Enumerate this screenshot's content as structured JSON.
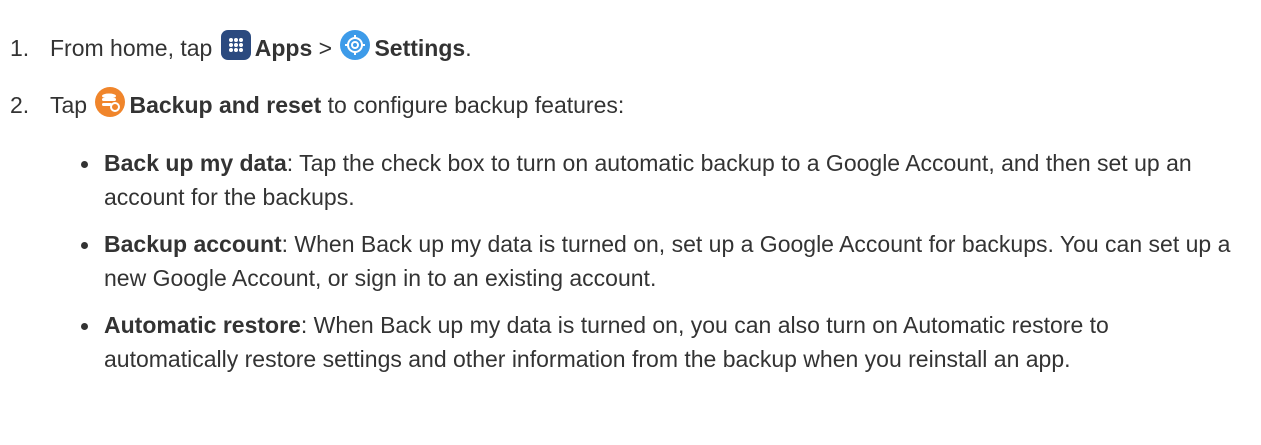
{
  "steps": [
    {
      "number": "1.",
      "text_before": "From home, tap",
      "apps_icon": "apps-grid-icon",
      "apps_label": "Apps",
      "separator": " > ",
      "settings_icon": "settings-gear-icon",
      "settings_label": "Settings",
      "text_after": "."
    },
    {
      "number": "2.",
      "text_before": "Tap",
      "backup_icon": "backup-reset-icon",
      "backup_label": "Backup and reset",
      "text_after": " to configure backup features:"
    }
  ],
  "bullets": [
    {
      "term": "Back up my data",
      "description": ": Tap the check box to turn on automatic backup to a Google Account, and then set up an account for the backups."
    },
    {
      "term": "Backup account",
      "description": ": When Back up my data is turned on, set up a Google Account for backups. You can set up a new Google Account, or sign in to an existing account."
    },
    {
      "term": "Automatic restore",
      "description": ": When Back up my data is turned on, you can also turn on Automatic restore to automatically restore settings and other information from the backup when you reinstall an app."
    }
  ],
  "colors": {
    "text": "#333333",
    "apps_icon_bg": "#2b4a7f",
    "settings_icon_bg": "#3d9be9",
    "backup_icon_bg": "#f0852b"
  }
}
